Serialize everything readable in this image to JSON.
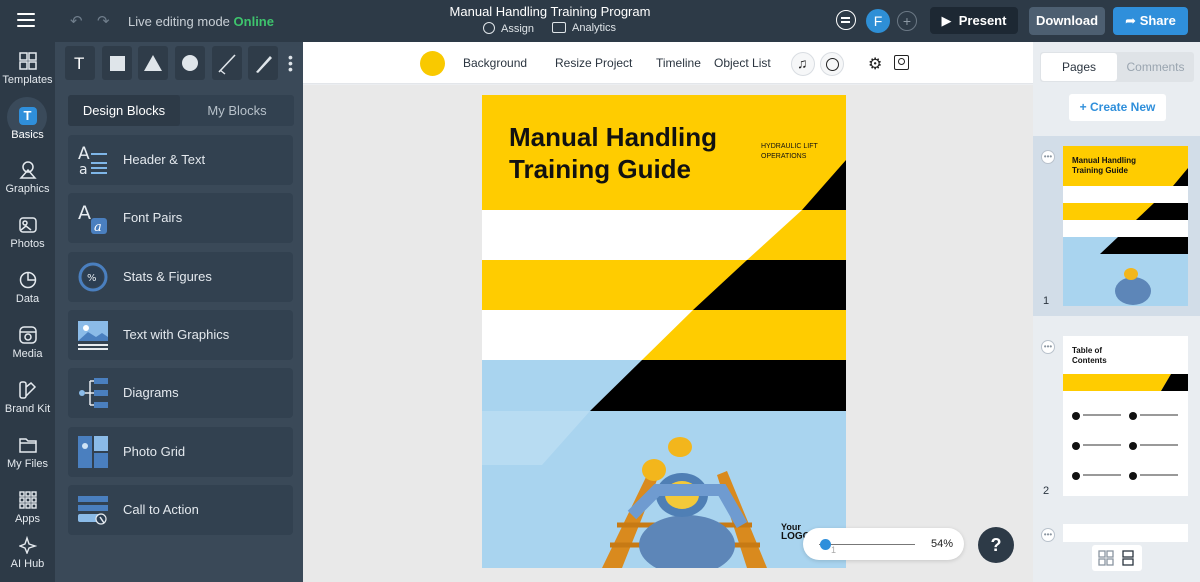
{
  "header": {
    "mode_label": "Live editing mode",
    "mode_status": "Online",
    "project_title": "Manual Handling Training Program",
    "assign_label": "Assign",
    "analytics_label": "Analytics",
    "avatar_initial": "F",
    "present_label": "Present",
    "download_label": "Download",
    "share_label": "Share"
  },
  "rail": {
    "items": [
      "Templates",
      "Basics",
      "Graphics",
      "Photos",
      "Data",
      "Media",
      "Brand Kit",
      "My Files",
      "Apps",
      "AI Hub"
    ],
    "active": "Basics",
    "active_glyph": "T"
  },
  "panel": {
    "tools": [
      "text-tool",
      "rectangle-tool",
      "triangle-tool",
      "circle-tool",
      "line-tool",
      "pen-tool"
    ],
    "text_tool_glyph": "T",
    "tabs": [
      "Design Blocks",
      "My Blocks"
    ],
    "blocks": [
      "Header & Text",
      "Font Pairs",
      "Stats & Figures",
      "Text with Graphics",
      "Diagrams",
      "Photo Grid",
      "Call to Action"
    ]
  },
  "canvas_toolbar": {
    "color": "#f9c900",
    "items": [
      "Background",
      "Resize Project",
      "Timeline",
      "Object List"
    ]
  },
  "page": {
    "title_line1": "Manual Handling",
    "title_line2": "Training Guide",
    "tag_line1": "HYDRAULIC LIFT",
    "tag_line2": "OPERATIONS",
    "logo_line1": "Your",
    "logo_line2": "LOGO",
    "colors": {
      "yellow": "#ffcc00",
      "black": "#000000",
      "sky": "#a9d4ef"
    }
  },
  "zoom": {
    "percent": "54%",
    "level": 0.04,
    "page_index": "1"
  },
  "help_label": "?",
  "right_panel": {
    "tabs": [
      "Pages",
      "Comments"
    ],
    "create_label": "+ Create New",
    "pages": [
      {
        "number": "1",
        "title_line1": "Manual Handling",
        "title_line2": "Training Guide"
      },
      {
        "number": "2",
        "title_line1": "Table of",
        "title_line2": "Contents"
      }
    ]
  }
}
